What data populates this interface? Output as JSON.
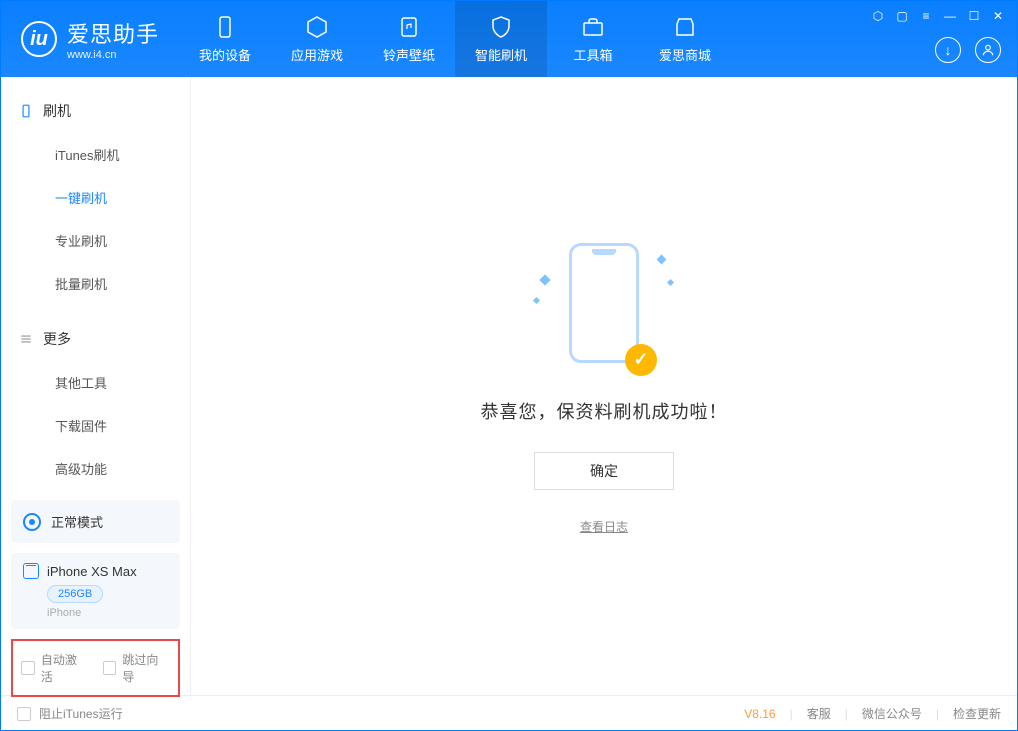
{
  "app": {
    "title": "爱思助手",
    "subtitle": "www.i4.cn"
  },
  "tabs": [
    {
      "label": "我的设备"
    },
    {
      "label": "应用游戏"
    },
    {
      "label": "铃声壁纸"
    },
    {
      "label": "智能刷机"
    },
    {
      "label": "工具箱"
    },
    {
      "label": "爱思商城"
    }
  ],
  "sidebar": {
    "sec1": {
      "title": "刷机",
      "items": [
        "iTunes刷机",
        "一键刷机",
        "专业刷机",
        "批量刷机"
      ]
    },
    "sec2": {
      "title": "更多",
      "items": [
        "其他工具",
        "下载固件",
        "高级功能"
      ]
    },
    "mode": "正常模式",
    "device": {
      "name": "iPhone XS Max",
      "capacity": "256GB",
      "type": "iPhone"
    },
    "checks": {
      "c1": "自动激活",
      "c2": "跳过向导"
    }
  },
  "main": {
    "success": "恭喜您，保资料刷机成功啦！",
    "ok": "确定",
    "log": "查看日志"
  },
  "footer": {
    "block_itunes": "阻止iTunes运行",
    "version": "V8.16",
    "links": [
      "客服",
      "微信公众号",
      "检查更新"
    ]
  }
}
